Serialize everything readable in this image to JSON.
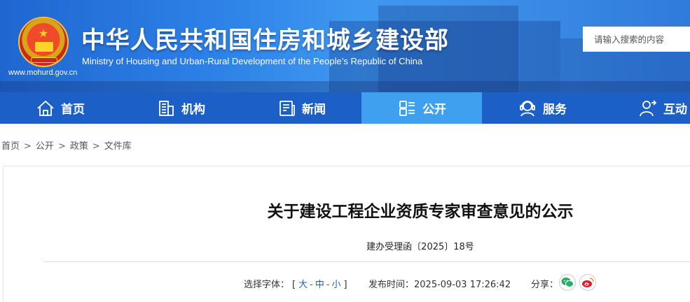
{
  "header": {
    "title_cn": "中华人民共和国住房和城乡建设部",
    "title_en": "Ministry of Housing and Urban-Rural Development of the People’s Republic of China",
    "url": "www.mohurd.gov.cn",
    "emblem_icon": "national-emblem-icon"
  },
  "search": {
    "placeholder": "请输入搜索的内容"
  },
  "nav": {
    "items": [
      {
        "label": "首页",
        "icon": "home-icon"
      },
      {
        "label": "机构",
        "icon": "building-icon"
      },
      {
        "label": "新闻",
        "icon": "news-icon"
      },
      {
        "label": "公开",
        "icon": "disclosure-icon",
        "active": true
      },
      {
        "label": "服务",
        "icon": "service-icon"
      },
      {
        "label": "互动",
        "icon": "interaction-icon"
      }
    ]
  },
  "breadcrumb": {
    "items": [
      "首页",
      "公开",
      "政策",
      "文件库"
    ],
    "separator": ">"
  },
  "article": {
    "title": "关于建设工程企业资质专家审查意见的公示",
    "doc_number": "建办受理函〔2025〕18号",
    "font_size_label": "选择字体：",
    "font_size_open": "[",
    "font_size_close": "]",
    "font_size_options": [
      "大",
      "中",
      "小"
    ],
    "font_size_dash": "-",
    "publish_label": "发布时间：",
    "publish_time": "2025-09-03 17:26:42",
    "share_label": "分享："
  },
  "colors": {
    "nav_bg": "#1b5fc7",
    "nav_active": "#3fa0ef",
    "link": "#1b5fc7",
    "wechat": "#2aae67",
    "weibo": "#e6162d"
  }
}
